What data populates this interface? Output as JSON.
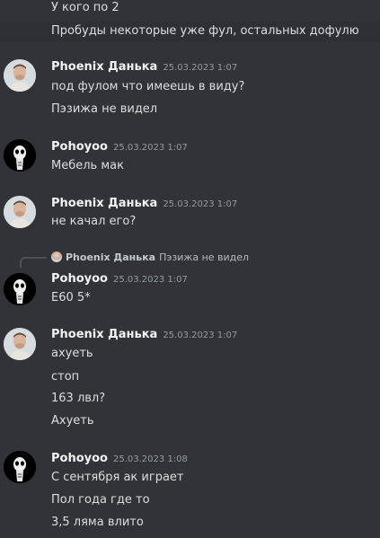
{
  "messages": {
    "top_cont_1": "У кого по 2",
    "top_cont_2": "Пробуды некоторые уже фул, остальных дофулю",
    "m1": {
      "author": "Phoenix Данька",
      "time": "25.03.2023 1:07",
      "lines": [
        "под фулом что имеешь в виду?",
        "Пэзижа не видел"
      ]
    },
    "m2": {
      "author": "Pohoyoo",
      "time": "25.03.2023 1:07",
      "lines": [
        "Мебель мак"
      ]
    },
    "m3": {
      "author": "Phoenix Данька",
      "time": "25.03.2023 1:07",
      "lines": [
        "не качал его?"
      ]
    },
    "m4": {
      "reply_author": "Phoenix Данька",
      "reply_text": "Пэзижа не видел",
      "author": "Pohoyoo",
      "time": "25.03.2023 1:07",
      "lines": [
        "E60 5*"
      ]
    },
    "m5": {
      "author": "Phoenix Данька",
      "time": "25.03.2023 1:07",
      "lines": [
        "ахуеть",
        "стоп",
        "163 лвл?",
        "Ахуеть"
      ]
    },
    "m6": {
      "author": "Pohoyoo",
      "time": "25.03.2023 1:08",
      "lines": [
        "С сентября ак играет",
        "Пол года где то",
        "3,5 ляма влито"
      ]
    }
  },
  "colors": {
    "background": "#313338",
    "username": "#f2f3f5",
    "timestamp": "#949ba4",
    "text": "#dbdee1"
  }
}
